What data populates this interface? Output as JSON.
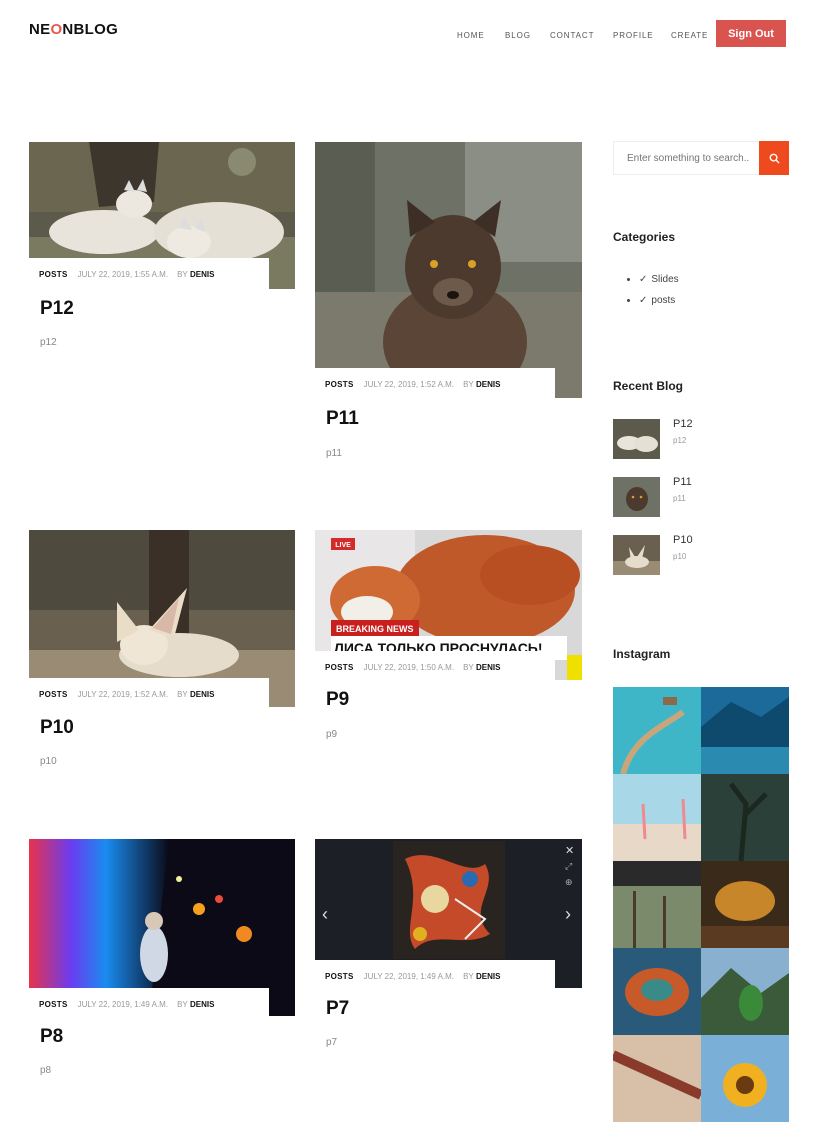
{
  "header": {
    "logo_pre": "NE",
    "logo_o": "O",
    "logo_post": "NBLOG",
    "nav": [
      "HOME",
      "BLOG",
      "CONTACT",
      "PROFILE",
      "CREATE"
    ],
    "signout_label": "Sign Out"
  },
  "posts": [
    {
      "category": "POSTS",
      "date": "JULY 22, 2019, 1:55 A.M.",
      "by": "BY",
      "author": "DENIS",
      "title": "P12",
      "excerpt": "p12"
    },
    {
      "category": "POSTS",
      "date": "JULY 22, 2019, 1:52 A.M.",
      "by": "BY",
      "author": "DENIS",
      "title": "P11",
      "excerpt": "p11"
    },
    {
      "category": "POSTS",
      "date": "JULY 22, 2019, 1:52 A.M.",
      "by": "BY",
      "author": "DENIS",
      "title": "P10",
      "excerpt": "p10"
    },
    {
      "category": "POSTS",
      "date": "JULY 22, 2019, 1:50 A.M.",
      "by": "BY",
      "author": "DENIS",
      "title": "P9",
      "excerpt": "p9"
    },
    {
      "category": "POSTS",
      "date": "JULY 22, 2019, 1:49 A.M.",
      "by": "BY",
      "author": "DENIS",
      "title": "P8",
      "excerpt": "p8"
    },
    {
      "category": "POSTS",
      "date": "JULY 22, 2019, 1:49 A.M.",
      "by": "BY",
      "author": "DENIS",
      "title": "P7",
      "excerpt": "p7"
    }
  ],
  "image_text": {
    "live_badge": "LIVE",
    "breaking_news": "BREAKING NEWS",
    "headline": "ЛИСА ТОЛЬКО ПРОСНУЛАСЬ!"
  },
  "sidebar": {
    "search_placeholder": "Enter something to search..",
    "categories_heading": "Categories",
    "categories": [
      "Slides",
      "posts"
    ],
    "recent_heading": "Recent Blog",
    "recent": [
      {
        "title": "P12",
        "excerpt": "p12"
      },
      {
        "title": "P11",
        "excerpt": "p11"
      },
      {
        "title": "P10",
        "excerpt": "p10"
      }
    ],
    "instagram_heading": "Instagram"
  },
  "colors": {
    "accent": "#d9534f",
    "search_button": "#ef4a1e",
    "logo_o": "#e8584f"
  }
}
